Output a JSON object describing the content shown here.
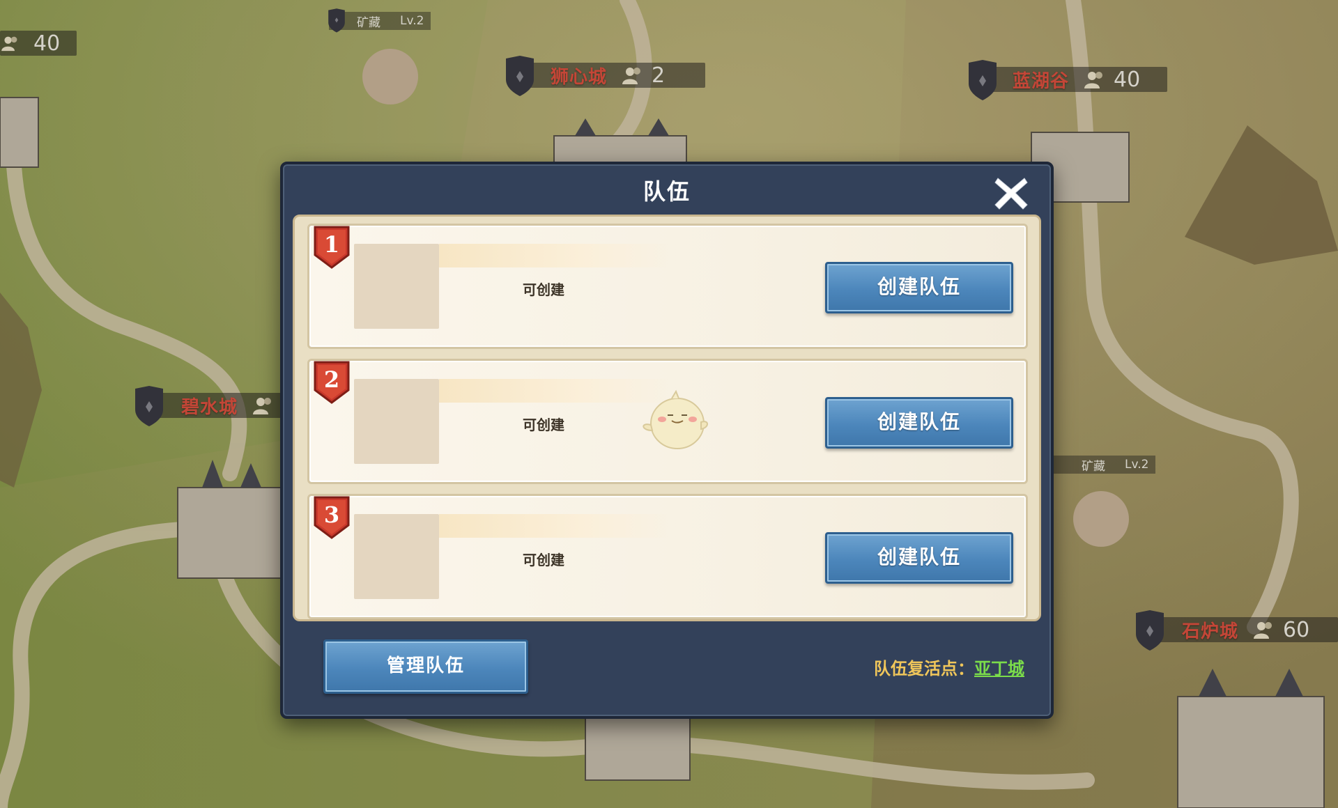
{
  "map": {
    "cities": [
      {
        "id": "shixincheng",
        "name": "狮心城",
        "population": "2"
      },
      {
        "id": "lanhugu",
        "name": "蓝湖谷",
        "population": "40"
      },
      {
        "id": "bishuicheng",
        "name": "碧水城",
        "population": ""
      },
      {
        "id": "shiluchengcheng",
        "name": "石炉城",
        "population": "60"
      },
      {
        "id": "topleft",
        "name": "",
        "population": "40"
      }
    ],
    "mines": [
      {
        "label": "矿藏",
        "level": "Lv.2"
      },
      {
        "label": "矿藏",
        "level": "Lv.2"
      }
    ]
  },
  "modal": {
    "title": "队伍",
    "slots": [
      {
        "number": "1",
        "status": "可创建",
        "button": "创建队伍"
      },
      {
        "number": "2",
        "status": "可创建",
        "button": "创建队伍"
      },
      {
        "number": "3",
        "status": "可创建",
        "button": "创建队伍"
      }
    ],
    "manage_button": "管理队伍",
    "respawn_label": "队伍复活点：",
    "respawn_city": "亚丁城"
  },
  "colors": {
    "modal_bg": "#33415a",
    "button_blue": "#4c86bb",
    "badge_red": "#c8372b",
    "city_red": "#e0503f",
    "respawn_gold": "#f0c65a",
    "respawn_green": "#7bdc4a"
  },
  "icons": {
    "close": "close-icon",
    "population": "people-icon",
    "shield": "shield-icon",
    "badge": "number-badge-icon",
    "mascot": "chick-mascot-icon"
  }
}
